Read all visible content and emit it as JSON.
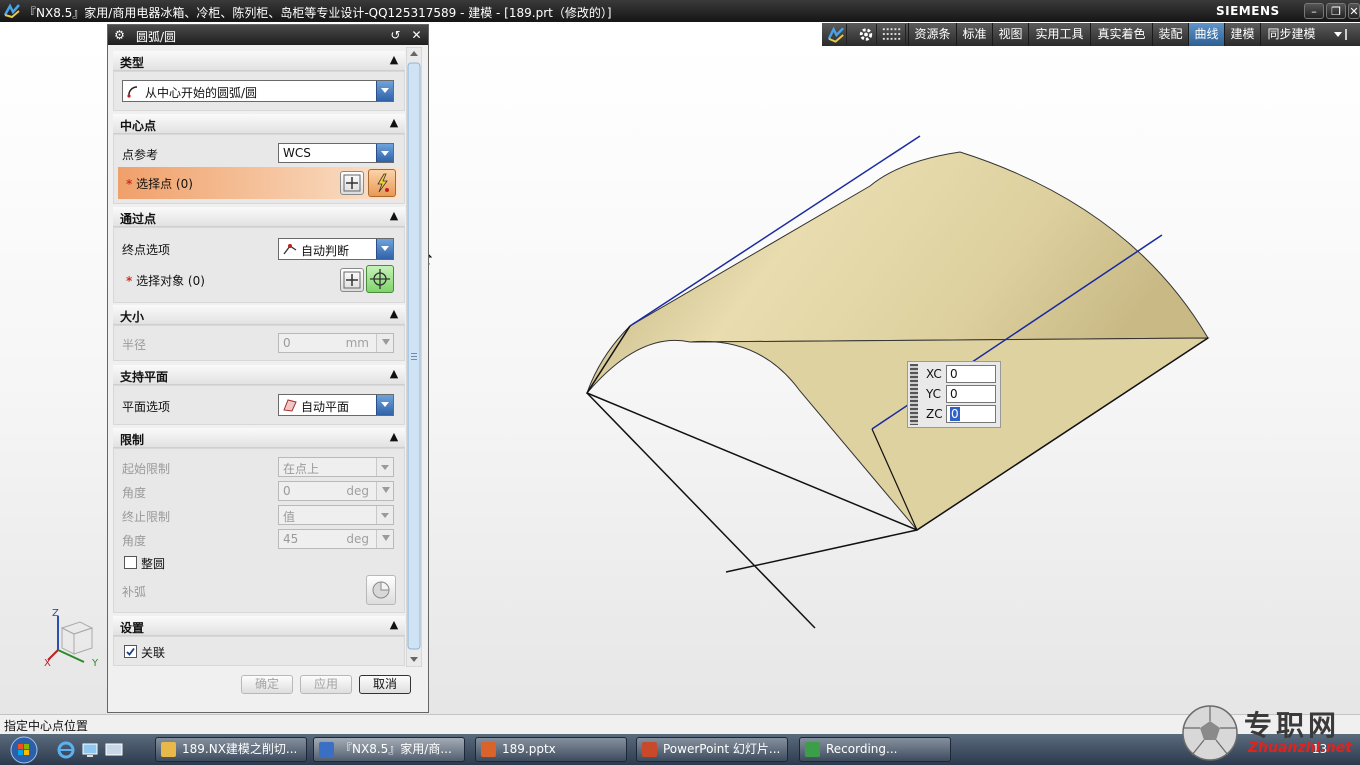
{
  "titlebar": {
    "title": "『NX8.5』家用/商用电器冰箱、冷柜、陈列柜、岛柜等专业设计-QQ125317589 - 建模 - [189.prt（修改的）]",
    "brand": "SIEMENS",
    "buttons": [
      "minimize",
      "restore",
      "close"
    ]
  },
  "toolbar": {
    "tabs": [
      {
        "label": "资源条",
        "active": false
      },
      {
        "label": "标准",
        "active": false
      },
      {
        "label": "视图",
        "active": false
      },
      {
        "label": "实用工具",
        "active": false
      },
      {
        "label": "真实着色",
        "active": false
      },
      {
        "label": "装配",
        "active": false
      },
      {
        "label": "曲线",
        "active": true
      },
      {
        "label": "建模",
        "active": false
      },
      {
        "label": "同步建模",
        "active": false
      }
    ]
  },
  "dialog": {
    "title": "圆弧/圆",
    "sections": {
      "type": {
        "header": "类型",
        "value": "从中心开始的圆弧/圆"
      },
      "center": {
        "header": "中心点",
        "point_ref_label": "点参考",
        "point_ref_value": "WCS",
        "select_point_label": "选择点 (0)"
      },
      "through": {
        "header": "通过点",
        "end_option_label": "终点选项",
        "end_option_value": "自动判断",
        "select_object_label": "选择对象 (0)"
      },
      "size": {
        "header": "大小",
        "radius_label": "半径",
        "radius_value": "0",
        "radius_unit": "mm"
      },
      "support": {
        "header": "支持平面",
        "plane_label": "平面选项",
        "plane_value": "自动平面"
      },
      "limits": {
        "header": "限制",
        "start_limit_label": "起始限制",
        "start_limit_value": "在点上",
        "angle1_label": "角度",
        "angle1_value": "0",
        "angle1_unit": "deg",
        "end_limit_label": "终止限制",
        "end_limit_value": "值",
        "angle2_label": "角度",
        "angle2_value": "45",
        "angle2_unit": "deg",
        "full_circle_label": "整圆",
        "full_circle_checked": false,
        "complement_label": "补弧"
      },
      "settings": {
        "header": "设置",
        "associative_label": "关联",
        "associative_checked": true
      }
    },
    "buttons": {
      "ok": "确定",
      "apply": "应用",
      "cancel": "取消"
    }
  },
  "coord_input": {
    "rows": [
      {
        "label": "XC",
        "value": "0"
      },
      {
        "label": "YC",
        "value": "0"
      },
      {
        "label": "ZC",
        "value": "0"
      }
    ]
  },
  "status": {
    "prompt": "指定中心点位置"
  },
  "triad": {
    "axis_z": "Z",
    "axis_y": "Y",
    "axis_x": "X"
  },
  "taskbar": {
    "items": [
      {
        "label": "189.NX建模之削切...",
        "active": false,
        "color": "#e8b84a"
      },
      {
        "label": "『NX8.5』家用/商...",
        "active": true,
        "color": "#3a6fc4"
      },
      {
        "label": "189.pptx",
        "active": false,
        "color": "#d9632a"
      },
      {
        "label": "PowerPoint 幻灯片...",
        "active": false,
        "color": "#c84a2a"
      },
      {
        "label": "Recording...",
        "active": false,
        "color": "#3d9e4a"
      }
    ],
    "clock": "13"
  },
  "watermark": {
    "cn": "专职网",
    "en": "Zhuanzhi.net"
  },
  "colors": {
    "surface_light": "#e9ddb0",
    "surface_dark": "#9c8b58",
    "blue_line": "#1a2aa0",
    "accent": "#2f62a8",
    "highlight_row": "#f3b07a"
  }
}
